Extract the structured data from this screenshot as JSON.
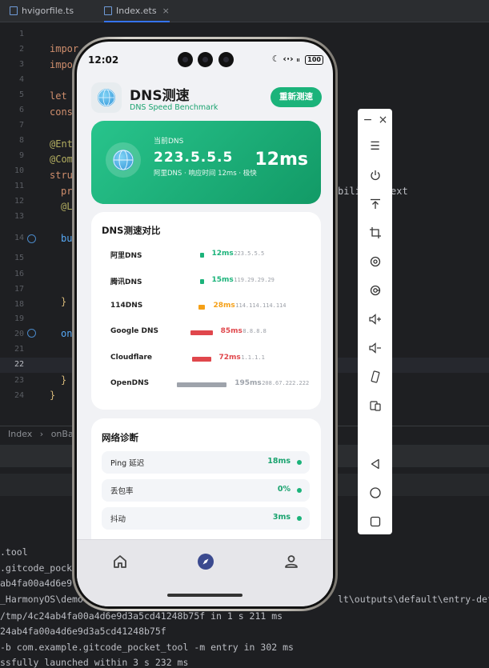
{
  "ide": {
    "tabs": [
      {
        "label": "hvigorfile.ts"
      },
      {
        "label": "Index.ets"
      }
    ],
    "line_numbers": [
      "1",
      "2",
      "3",
      "4",
      "5",
      "6",
      "7",
      "8",
      "9",
      "10",
      "11",
      "12",
      "13",
      "14",
      "15",
      "16",
      "17",
      "18",
      "19",
      "20",
      "21",
      "22",
      "23",
      "24"
    ],
    "code_fragments": {
      "l2": "impor",
      "l3": "impo",
      "l5": "let",
      "l6": "cons",
      "l8": "@Ent",
      "l9": "@Com",
      "l10": "stru",
      "l11": "pr",
      "l11_tail": "bili",
      "l11_right": "ext",
      "l12": "@L",
      "l14": "bu",
      "l17": "}",
      "l20": "on",
      "l23": "}",
      "l24": "}"
    },
    "breadcrumb": [
      "Index",
      "onBac"
    ],
    "log_lines": [
      ".tool",
      ".gitcode_pock",
      "ab4fa00a4d6e9",
      "4ab4fa00a4d6e9",
      "_HarmonyOS\\demo",
      "/tmp/4c24ab4fa00a4d6e9d3a5cd41248b75f in 1 s 211 ms",
      "24ab4fa00a4d6e9d3a5cd41248b75f",
      "-b com.example.gitcode_pocket_tool -m entry in 302 ms",
      "ssfully launched within 3 s 232 ms"
    ],
    "log_right_fragment": "lt\\outputs\\default\\entry-def"
  },
  "phone": {
    "status": {
      "time": "12:02",
      "battery": "100"
    },
    "header": {
      "title": "DNS测速",
      "subtitle": "DNS Speed Benchmark",
      "retest_label": "重新测速"
    },
    "hero": {
      "label": "当前DNS",
      "ip": "223.5.5.5",
      "description": "阿里DNS · 响应时间 12ms · 极快",
      "latency": "12ms"
    },
    "compare": {
      "title": "DNS测速对比",
      "rows": [
        {
          "name": "阿里DNS",
          "latency": "12ms",
          "ip": "223.5.5.5",
          "color": "#1bb37a",
          "value_ms": 12
        },
        {
          "name": "腾讯DNS",
          "latency": "15ms",
          "ip": "119.29.29.29",
          "color": "#1bb37a",
          "value_ms": 15
        },
        {
          "name": "114DNS",
          "latency": "28ms",
          "ip": "114.114.114.114",
          "color": "#f5a017",
          "value_ms": 28
        },
        {
          "name": "Google DNS",
          "latency": "85ms",
          "ip": "8.8.8.8",
          "color": "#e0474c",
          "value_ms": 85
        },
        {
          "name": "Cloudflare",
          "latency": "72ms",
          "ip": "1.1.1.1",
          "color": "#e0474c",
          "value_ms": 72
        },
        {
          "name": "OpenDNS",
          "latency": "195ms",
          "ip": "208.67.222.222",
          "color": "#9ea3ab",
          "value_ms": 195
        }
      ]
    },
    "diagnosis": {
      "title": "网络诊断",
      "rows": [
        {
          "key": "Ping 延迟",
          "value": "18ms"
        },
        {
          "key": "丢包率",
          "value": "0%"
        },
        {
          "key": "抖动",
          "value": "3ms"
        }
      ]
    },
    "tabbar": {
      "items": [
        {
          "icon": "home-icon"
        },
        {
          "icon": "compass-icon"
        },
        {
          "icon": "person-icon"
        }
      ]
    }
  },
  "emulator_toolbar": {
    "buttons": [
      "minimize-icon",
      "close-icon",
      "menu-icon",
      "power-icon",
      "pin-top-icon",
      "crop-icon",
      "rotate-icon",
      "location-icon",
      "volume-up-icon",
      "volume-down-icon",
      "shake-icon",
      "fold-icon",
      "back-icon",
      "home-circle-icon",
      "recent-square-icon"
    ]
  },
  "colors": {
    "accent": "#1bb37a",
    "warning": "#f5a017",
    "danger": "#e0474c"
  }
}
